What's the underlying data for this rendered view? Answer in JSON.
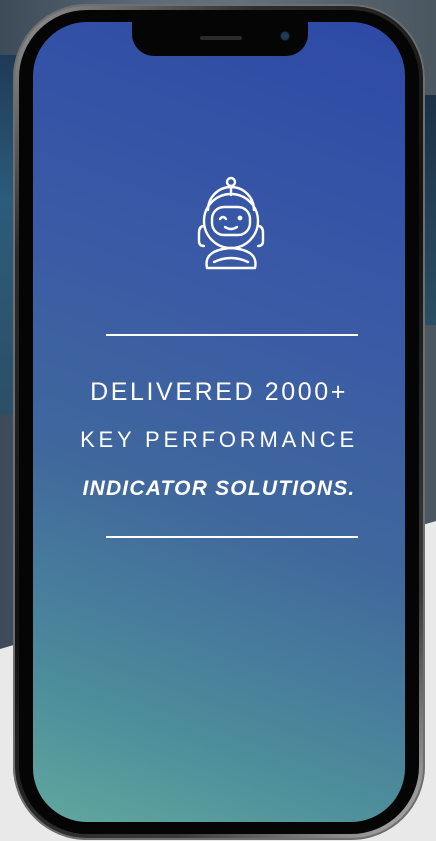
{
  "icons": {
    "robot": "robot-icon"
  },
  "colors": {
    "screen_top": "#2d49a6",
    "screen_bottom": "#62a79e",
    "text": "#ffffff"
  },
  "message": {
    "line1": "DELIVERED 2000+",
    "line2": "KEY PERFORMANCE",
    "line3": "INDICATOR SOLUTIONS."
  }
}
